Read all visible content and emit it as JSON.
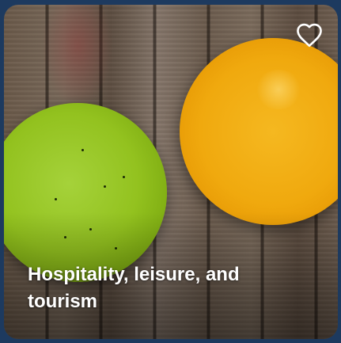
{
  "card": {
    "title": "Hospitality, leisure, and tourism",
    "favorite_icon": "heart-outline-icon",
    "image_icon": "juice-glasses-photo"
  },
  "colors": {
    "frame": "#1d3a5f",
    "title_text": "#ffffff",
    "heart_stroke": "#ffffff"
  }
}
